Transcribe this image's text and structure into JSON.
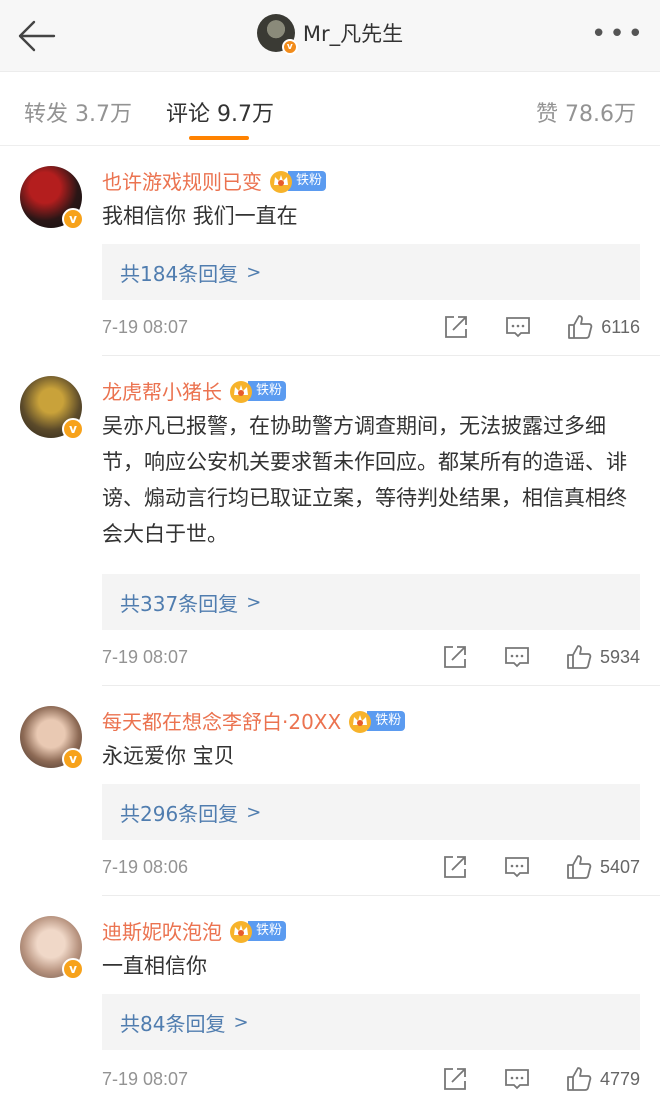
{
  "header": {
    "title": "Mr_凡先生",
    "back_icon": "arrow-left-icon",
    "more_icon": "more-dots-icon",
    "more_text": "•••"
  },
  "tabs": [
    {
      "label": "转发 3.7万"
    },
    {
      "label": "评论 9.7万"
    },
    {
      "label": "赞 78.6万"
    }
  ],
  "accent": "#ff8200",
  "name_color": "#eb7350",
  "link_color": "#507daf",
  "fan_badge_label": "铁粉",
  "comments": [
    {
      "name": "也许游戏规则已变",
      "text": "我相信你 我们一直在",
      "reply": "共184条回复",
      "time": "7-19 08:07",
      "likes": "6116"
    },
    {
      "name": "龙虎帮小猪长",
      "text": "吴亦凡已报警，在协助警方调查期间，无法披露过多细节，响应公安机关要求暂未作回应。都某所有的造谣、诽谤、煽动言行均已取证立案，等待判处结果，相信真相终会大白于世。",
      "reply": "共337条回复",
      "time": "7-19 08:07",
      "likes": "5934"
    },
    {
      "name": "每天都在想念李舒白·20XX",
      "text": "永远爱你 宝贝",
      "reply": "共296条回复",
      "time": "7-19 08:06",
      "likes": "5407"
    },
    {
      "name": "迪斯妮吹泡泡",
      "text": "一直相信你",
      "reply": "共84条回复",
      "time": "7-19 08:07",
      "likes": "4779"
    }
  ]
}
